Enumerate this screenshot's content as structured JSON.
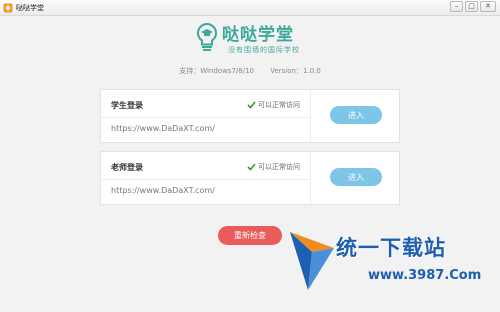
{
  "window": {
    "title": "哒哒学堂",
    "controls": {
      "minimize": "–",
      "maximize": "□",
      "close": "✕"
    }
  },
  "logo": {
    "name": "哒哒学堂",
    "slogan": "没有围墙的国际学校",
    "icon": "lightbulb-graduation-cap-icon",
    "color": "#3fa89c"
  },
  "support": {
    "os": "支持：Windows7/8/10",
    "version": "Version：1.0.0"
  },
  "cards": {
    "student": {
      "title": "学生登录",
      "status": "可以正常访问",
      "url": "https://www.DaDaXT.com/",
      "button": "进入"
    },
    "teacher": {
      "title": "老师登录",
      "status": "可以正常访问",
      "url": "https://www.DaDaXT.com/",
      "button": "进入"
    }
  },
  "recheck_button": "重新检查",
  "watermark": {
    "name": "统一下载站",
    "url": "www.3987.Com",
    "icon": "arrow-triangle-logo-icon"
  },
  "colors": {
    "accent": "#3fa89c",
    "button_blue": "#7ec6e8",
    "button_red": "#e85c5c",
    "status_green": "#2a9d3a",
    "watermark_blue": "#1d5fb0"
  }
}
